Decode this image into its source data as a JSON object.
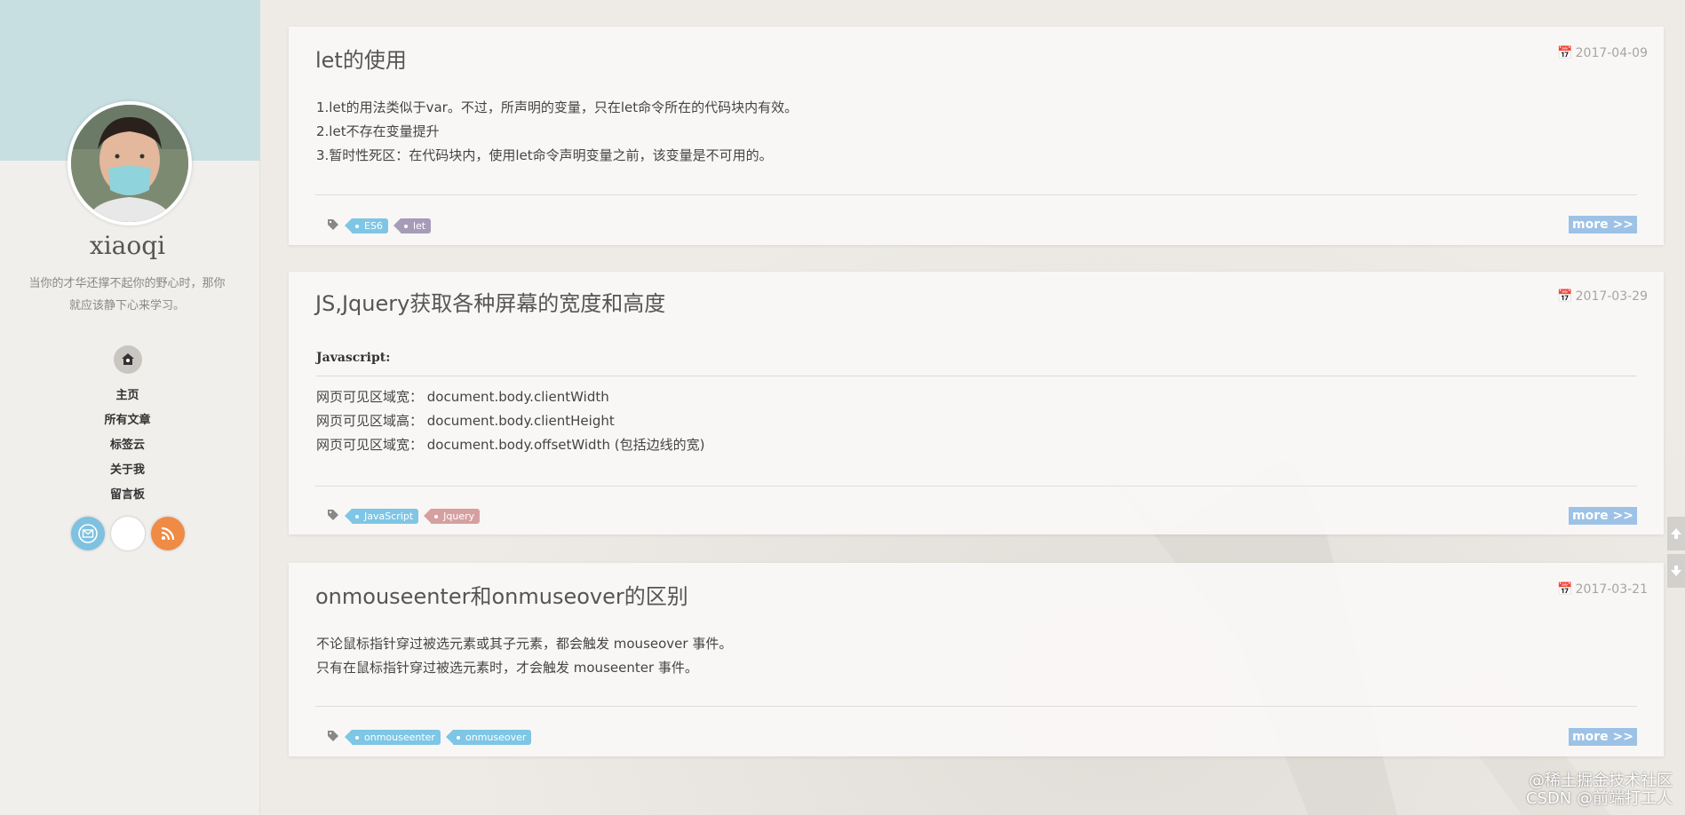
{
  "sidebar": {
    "author": "xiaoqi",
    "motto": "当你的才华还撑不起你的野心时，那你就应该静下心来学习。",
    "nav": [
      "主页",
      "所有文章",
      "标签云",
      "关于我",
      "留言板"
    ],
    "icons": {
      "home": "home-icon",
      "mail": "mail-icon",
      "rss": "rss-icon"
    }
  },
  "posts": [
    {
      "title": "let的使用",
      "date": "2017-04-09",
      "lines": [
        "1.let的用法类似于var。不过，所声明的变量，只在let命令所在的代码块内有效。",
        "2.let不存在变量提升",
        "3.暂时性死区：在代码块内，使用let命令声明变量之前，该变量是不可用的。"
      ],
      "tags": [
        {
          "label": "ES6",
          "color": "#7ec6e5"
        },
        {
          "label": "let",
          "color": "#a79cb8"
        }
      ],
      "more": "more >>"
    },
    {
      "title": "JS,Jquery获取各种屏幕的宽度和高度",
      "date": "2017-03-29",
      "heading": "Javascript:",
      "lines": [
        "网页可见区域宽：  document.body.clientWidth",
        "网页可见区域高：  document.body.clientHeight",
        "网页可见区域宽：  document.body.offsetWidth (包括边线的宽)"
      ],
      "tags": [
        {
          "label": "JavaScript",
          "color": "#7ec6e5"
        },
        {
          "label": "Jquery",
          "color": "#d6a0a0"
        }
      ],
      "more": "more >>"
    },
    {
      "title": "onmouseenter和onmuseover的区别",
      "date": "2017-03-21",
      "lines": [
        "不论鼠标指针穿过被选元素或其子元素，都会触发 mouseover 事件。",
        "只有在鼠标指针穿过被选元素时，才会触发 mouseenter 事件。"
      ],
      "tags": [
        {
          "label": "onmouseenter",
          "color": "#7ec6e5"
        },
        {
          "label": "onmuseover",
          "color": "#7ec6e5"
        }
      ],
      "more": "more >>"
    }
  ],
  "watermark": {
    "line1": "@稀土掘金技术社区",
    "line2": "CSDN @前端打工人"
  }
}
